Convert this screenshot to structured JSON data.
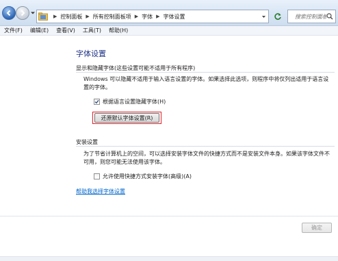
{
  "address_bar": {
    "breadcrumbs": [
      "控制面板",
      "所有控制面板项",
      "字体",
      "字体设置"
    ],
    "search_placeholder": "搜索控制面板"
  },
  "menu": {
    "items": [
      "文件(F)",
      "编辑(E)",
      "查看(V)",
      "工具(T)",
      "帮助(H)"
    ]
  },
  "page": {
    "title": "字体设置",
    "section1": {
      "header": "显示和隐藏字体(这些设置可能不适用于所有程序)",
      "description": "Windows 可以隐藏不适用于输入语言设置的字体。如果选择此选项，则程序中将仅列出适用于语言设置的字体。",
      "checkbox_label": "根据语言设置隐藏字体(H)",
      "checkbox_checked": true,
      "restore_button": "还原默认字体设置(R)"
    },
    "section2": {
      "header": "安装设置",
      "description": "为了节省计算机上的空间，可以选择安装字体文件的快捷方式而不是安装文件本身。如果该字体文件不可用，则您可能无法使用该字体。",
      "checkbox_label": "允许使用快捷方式安装字体(高级)(A)",
      "checkbox_checked": false
    },
    "help_link": "帮助我选择字体设置",
    "ok_button": "确定"
  },
  "colors": {
    "title": "#1e3287",
    "link": "#0066cc",
    "highlight_border": "#e0202a"
  }
}
